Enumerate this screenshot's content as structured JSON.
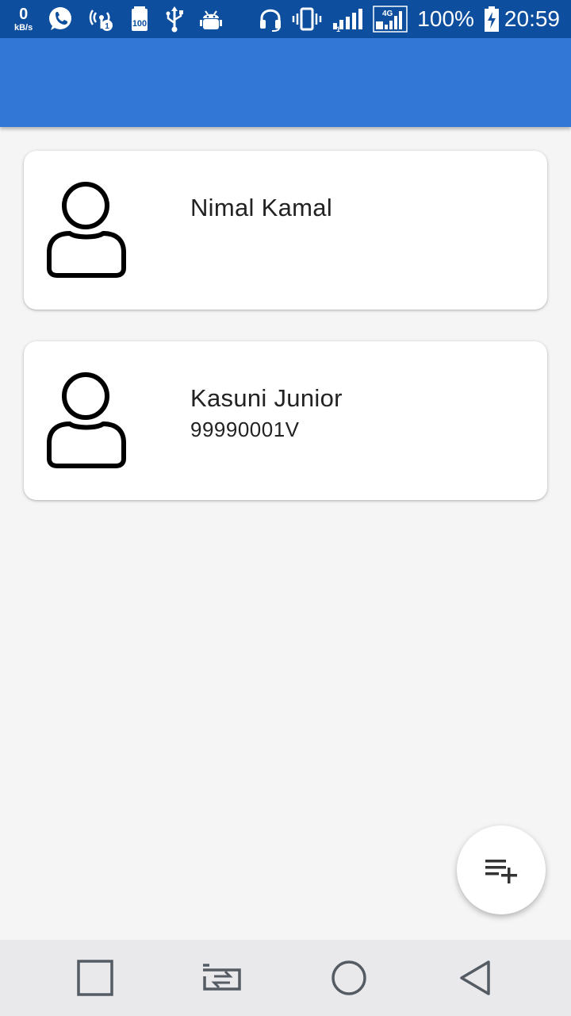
{
  "status_bar": {
    "speed_value": "0",
    "speed_unit": "kB/s",
    "icons": [
      "whatsapp-icon",
      "hotspot-icon",
      "storage-icon",
      "usb-icon",
      "android-debug-icon",
      "headset-icon",
      "vibrate-icon",
      "signal-icon",
      "network-4g-icon"
    ],
    "network_label": "4G",
    "battery_percent": "100%",
    "time": "20:59"
  },
  "app_bar": {
    "background": "#3276d6"
  },
  "contacts": [
    {
      "name": "Nimal Kamal",
      "id_number": ""
    },
    {
      "name": "Kasuni Junior",
      "id_number": "99990001V"
    }
  ],
  "fab": {
    "icon": "playlist-add-icon"
  },
  "nav_bar": {
    "icons": [
      "recents-icon",
      "switch-apps-icon",
      "home-icon",
      "back-icon"
    ]
  }
}
